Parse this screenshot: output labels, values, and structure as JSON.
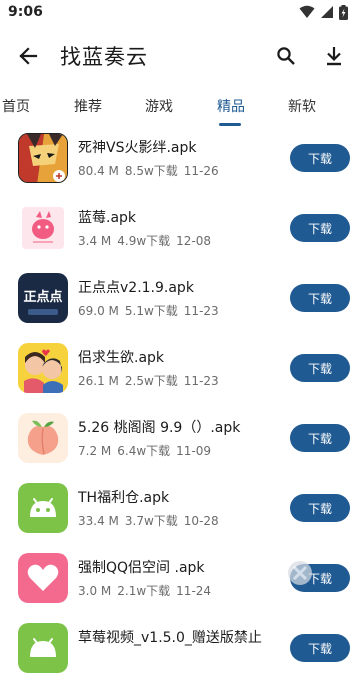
{
  "status": {
    "time": "9:06"
  },
  "header": {
    "title": "找蓝奏云"
  },
  "tabs": [
    {
      "label": "首页"
    },
    {
      "label": "推荐"
    },
    {
      "label": "游戏"
    },
    {
      "label": "精品"
    },
    {
      "label": "新软"
    }
  ],
  "active_tab": "精品",
  "download_label": "下载",
  "apps": [
    {
      "name": "死神VS火影绊.apk",
      "size": "80.4 M",
      "downloads": "8.5w下载",
      "date": "11-26",
      "icon": "anime-game-icon"
    },
    {
      "name": "蓝莓.apk",
      "size": "3.4 M",
      "downloads": "4.9w下载",
      "date": "12-08",
      "icon": "pink-bird-icon"
    },
    {
      "name": "正点点v2.1.9.apk",
      "size": "69.0 M",
      "downloads": "5.1w下载",
      "date": "11-23",
      "icon": "zhengdiandian-logo-icon",
      "icon_text": "正点点"
    },
    {
      "name": "侣求生欲.apk",
      "size": "26.1 M",
      "downloads": "2.5w下载",
      "date": "11-23",
      "icon": "couple-cartoon-icon"
    },
    {
      "name": "5.26 桃阁阁 9.9（）.apk",
      "size": "7.2 M",
      "downloads": "6.4w下载",
      "date": "11-09",
      "icon": "peach-icon"
    },
    {
      "name": "TH福利仓.apk",
      "size": "33.4 M",
      "downloads": "3.7w下载",
      "date": "10-28",
      "icon": "android-robot-icon"
    },
    {
      "name": "强制QQ侣空间 .apk",
      "size": "3.0 M",
      "downloads": "2.1w下载",
      "date": "11-24",
      "icon": "heart-icon"
    },
    {
      "name": "草莓视频_v1.5.0_赠送版禁止",
      "size": "",
      "downloads": "",
      "date": "",
      "icon": "android-robot-icon"
    }
  ],
  "colors": {
    "accent": "#1f5a93",
    "android_green": "#7cc348",
    "heart_pink": "#f46a8e"
  }
}
